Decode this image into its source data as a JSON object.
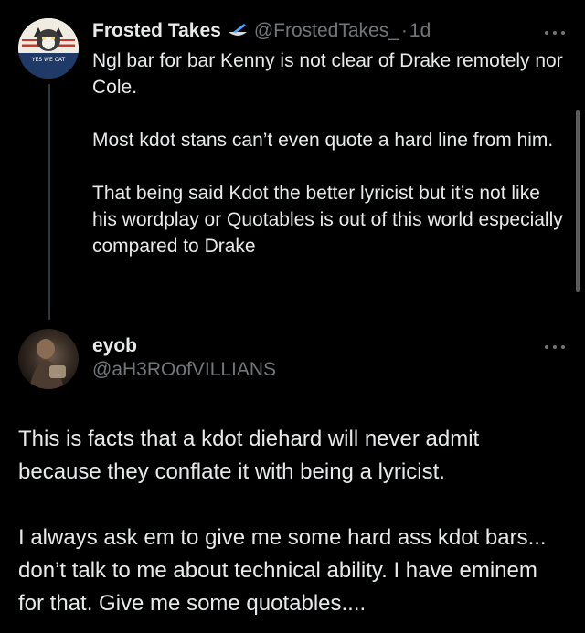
{
  "tweet": {
    "display_name": "Frosted Takes",
    "handle": "@FrostedTakes_",
    "separator": "·",
    "time": "1d",
    "avatar_text": "YES WE CAT",
    "paragraphs": [
      "Ngl bar for bar Kenny is not clear of Drake remotely nor Cole.",
      "Most kdot stans can’t even quote a hard line from him.",
      "That being said Kdot the better lyricist but it’s not like his wordplay or Quotables is out of this world especially compared to Drake"
    ]
  },
  "reply": {
    "display_name": "eyob",
    "handle": "@aH3ROofVILLIANS",
    "paragraphs": [
      "This is facts that a kdot diehard will never admit because they conflate it with being a lyricist.",
      "I always ask em to give me some hard ass kdot bars... don’t talk to me about technical ability. I have eminem for that. Give me some quotables...."
    ]
  },
  "icons": {
    "verified": "pen-badge-icon",
    "more": "more-icon"
  },
  "colors": {
    "background": "#000000",
    "text": "#e7e9ea",
    "secondary": "#71767b",
    "thread_line": "#333639"
  }
}
